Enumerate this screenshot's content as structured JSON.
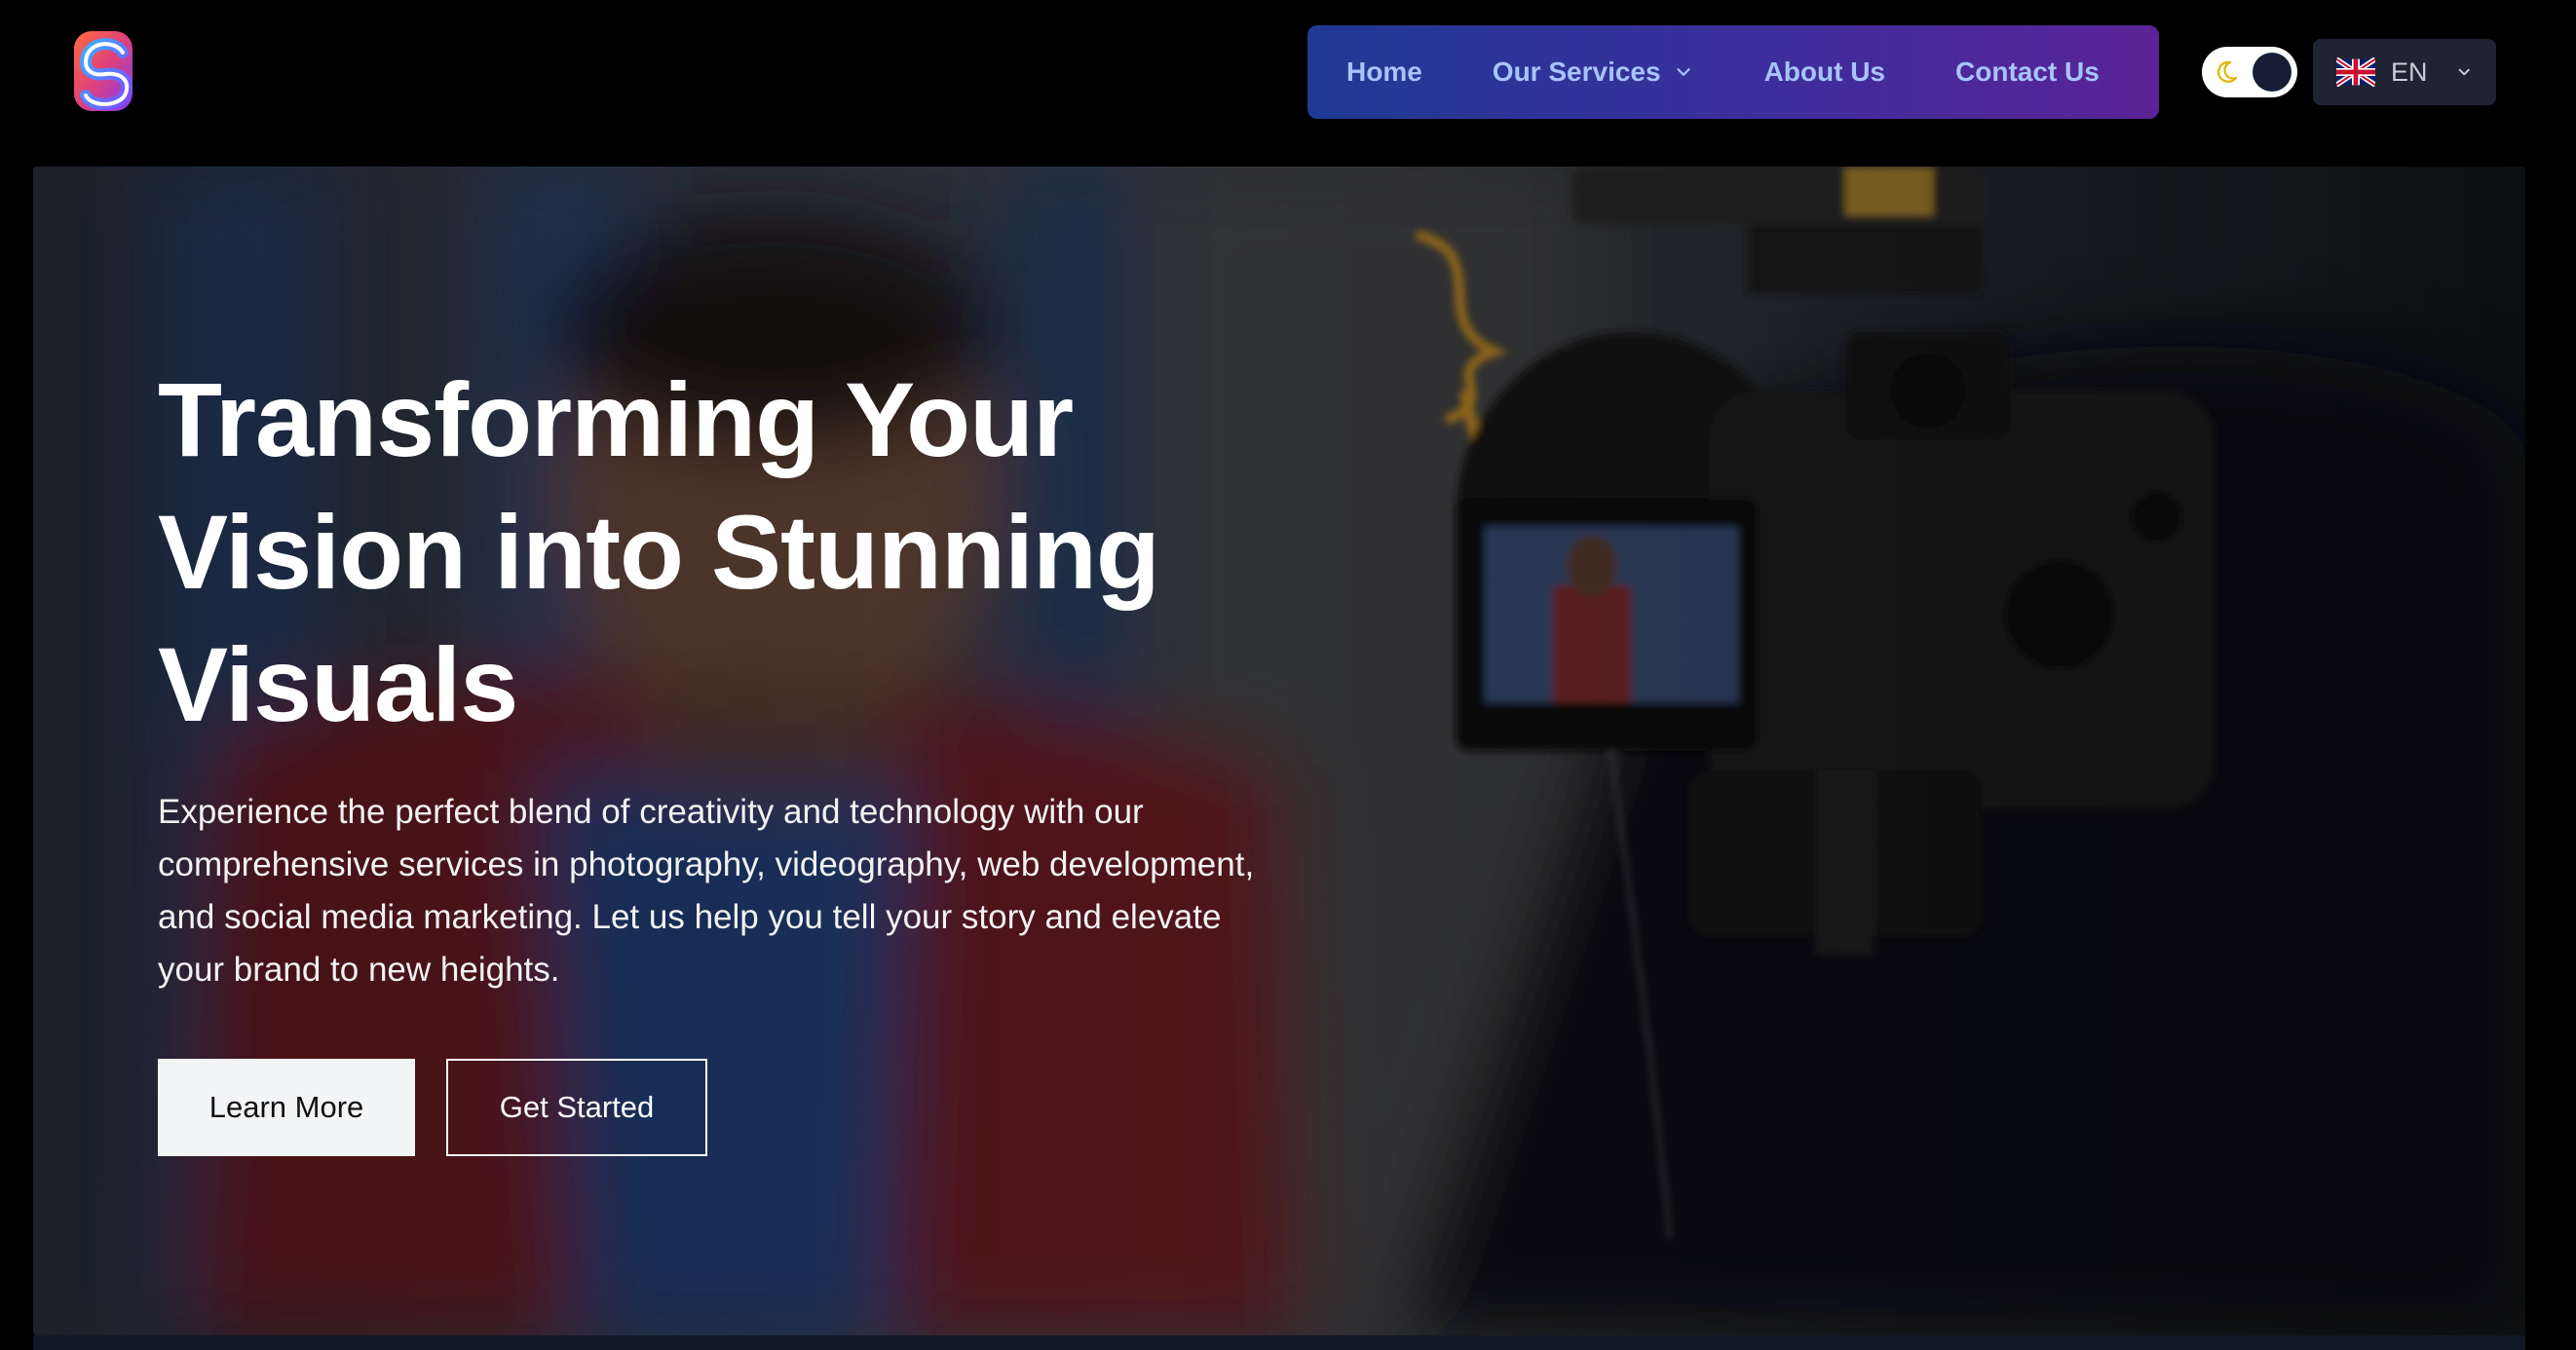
{
  "header": {
    "logo_icon": "brand-logo-icon",
    "nav": {
      "items": [
        {
          "label": "Home",
          "has_dropdown": false
        },
        {
          "label": "Our Services",
          "has_dropdown": true
        },
        {
          "label": "About Us",
          "has_dropdown": false
        },
        {
          "label": "Contact Us",
          "has_dropdown": false
        }
      ],
      "gradient_start": "#1f3a93",
      "gradient_end": "#5b2396",
      "text_color": "#a8c4ff"
    },
    "theme_toggle": {
      "icon": "moon-icon",
      "state": "dark"
    },
    "language": {
      "flag_icon": "uk-flag-icon",
      "code": "EN",
      "chevron_icon": "chevron-down-icon"
    }
  },
  "hero": {
    "title": "Transforming Your Vision into Stunning Visuals",
    "description": "Experience the perfect blend of creativity and technology with our comprehensive services in photography, videography, web development, and social media marketing. Let us help you tell your story and elevate your brand to new heights.",
    "primary_button": "Learn More",
    "secondary_button": "Get Started"
  }
}
